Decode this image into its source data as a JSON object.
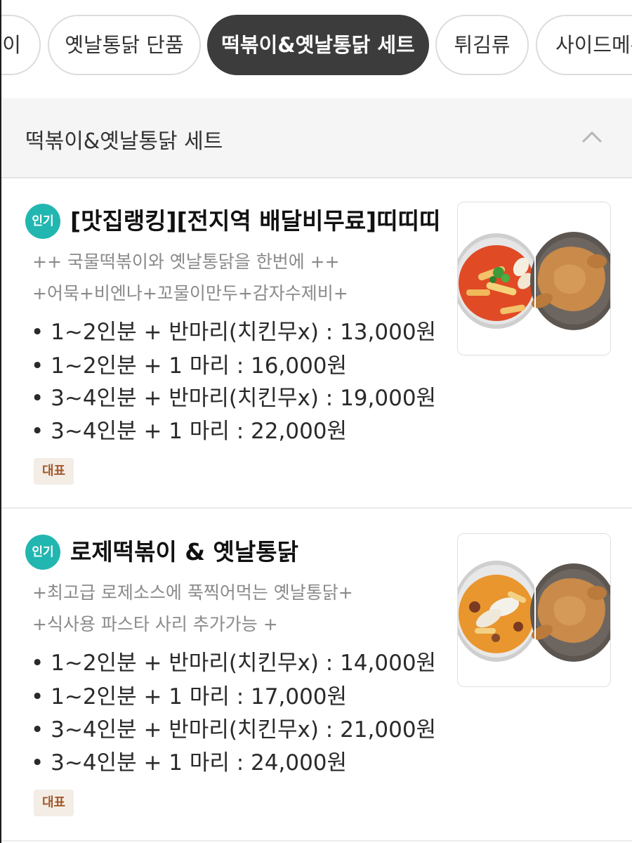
{
  "category_tabs": [
    {
      "label": "볶이",
      "active": false
    },
    {
      "label": "옛날통닭 단품",
      "active": false
    },
    {
      "label": "떡볶이&옛날통닭 세트",
      "active": true
    },
    {
      "label": "튀김류",
      "active": false
    },
    {
      "label": "사이드메뉴",
      "active": false
    }
  ],
  "section": {
    "title": "떡볶이&옛날통닭 세트",
    "collapse_icon": "chevron-up-icon"
  },
  "menu_items": [
    {
      "badge": "인기",
      "name": "[맛집랭킹][전지역 배달비무료]띠띠띠",
      "description": [
        "++ 국물떡볶이와 옛날통닭을 한번에 ++",
        "+어묵+비엔나+꼬물이만두+감자수제비+"
      ],
      "price_options": [
        "• 1~2인분 + 반마리(치킨무x) : 13,000원",
        "• 1~2인분 + 1 마리 : 16,000원",
        "• 3~4인분 + 반마리(치킨무x) : 19,000원",
        "• 3~4인분 + 1 마리 : 22,000원"
      ],
      "tag": "대표",
      "image": "tteokbokki-and-fried-chicken-photo"
    },
    {
      "badge": "인기",
      "name": "로제떡볶이 & 옛날통닭",
      "description": [
        "+최고급 로제소스에 푹찍어먹는 옛날통닭+",
        "+식사용 파스타 사리 추가가능 +"
      ],
      "price_options": [
        "• 1~2인분 + 반마리(치킨무x) : 14,000원",
        "• 1~2인분 + 1 마리 : 17,000원",
        "• 3~4인분 + 반마리(치킨무x) : 21,000원",
        "• 3~4인분 + 1 마리 : 24,000원"
      ],
      "tag": "대표",
      "image": "rose-tteokbokki-and-fried-chicken-photo"
    }
  ],
  "colors": {
    "active_chip": "#3c3c3c",
    "popular_badge": "#22b6b0",
    "rep_tag_bg": "#f3ede6",
    "rep_tag_text": "#a35a2b",
    "red_sauce": "#e04a25",
    "rose_sauce": "#e9962e",
    "chicken": "#c98a4a"
  }
}
